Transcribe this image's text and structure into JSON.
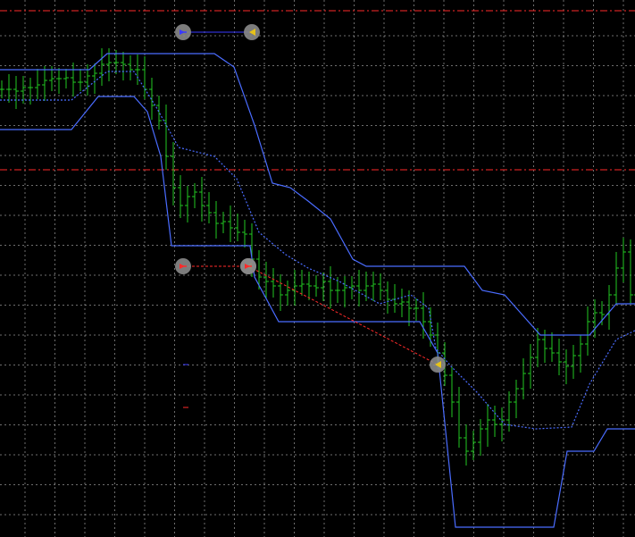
{
  "colors": {
    "background": "#000000",
    "grid": "#c8c8c8",
    "bars": "#22c922",
    "channel": "#4a6cff",
    "midline": "#4a6cff",
    "level": "#ff2a2a",
    "trade_loss": "#ff2a2a",
    "trade_win": "#3a3aff",
    "marker_bg": "#8a8a8a",
    "arrow_close": "#e6c21a",
    "arrow_open": "#ff2a2a"
  },
  "icons": {
    "open_marker": "trade-open-arrow-icon",
    "close_marker": "trade-close-arrow-icon"
  },
  "chart_data": {
    "type": "line",
    "series": [
      {
        "kind": "channel-upper",
        "points": [
          [
            0,
            78
          ],
          [
            100,
            78
          ],
          [
            120,
            60
          ],
          [
            240,
            60
          ],
          [
            262,
            75
          ],
          [
            285,
            140
          ],
          [
            305,
            205
          ],
          [
            325,
            210
          ],
          [
            345,
            225
          ],
          [
            370,
            245
          ],
          [
            395,
            290
          ],
          [
            410,
            298
          ],
          [
            520,
            298
          ],
          [
            540,
            325
          ],
          [
            565,
            330
          ],
          [
            605,
            375
          ],
          [
            660,
            375
          ],
          [
            690,
            340
          ],
          [
            711,
            340
          ]
        ]
      },
      {
        "kind": "channel-lower",
        "points": [
          [
            0,
            145
          ],
          [
            80,
            145
          ],
          [
            110,
            108
          ],
          [
            150,
            108
          ],
          [
            165,
            125
          ],
          [
            180,
            175
          ],
          [
            192,
            275
          ],
          [
            280,
            275
          ],
          [
            285,
            310
          ],
          [
            312,
            360
          ],
          [
            470,
            360
          ],
          [
            490,
            395
          ],
          [
            510,
            590
          ],
          [
            620,
            590
          ],
          [
            635,
            505
          ],
          [
            665,
            505
          ],
          [
            680,
            480
          ],
          [
            711,
            480
          ]
        ]
      },
      {
        "kind": "channel-mid",
        "points": [
          [
            0,
            112
          ],
          [
            80,
            112
          ],
          [
            120,
            80
          ],
          [
            150,
            80
          ],
          [
            175,
            120
          ],
          [
            200,
            165
          ],
          [
            240,
            175
          ],
          [
            265,
            200
          ],
          [
            290,
            260
          ],
          [
            320,
            285
          ],
          [
            345,
            300
          ],
          [
            380,
            315
          ],
          [
            425,
            340
          ],
          [
            460,
            330
          ],
          [
            480,
            345
          ],
          [
            488,
            390
          ],
          [
            505,
            410
          ],
          [
            535,
            440
          ],
          [
            565,
            475
          ],
          [
            600,
            480
          ],
          [
            640,
            478
          ],
          [
            660,
            430
          ],
          [
            690,
            380
          ],
          [
            711,
            370
          ]
        ]
      },
      {
        "kind": "price-bars",
        "points": [
          [
            0,
            100
          ],
          [
            8,
            100
          ],
          [
            16,
            102
          ],
          [
            24,
            98
          ],
          [
            32,
            98
          ],
          [
            40,
            95
          ],
          [
            48,
            90
          ],
          [
            56,
            88
          ],
          [
            64,
            88
          ],
          [
            72,
            87
          ],
          [
            80,
            92
          ],
          [
            88,
            92
          ],
          [
            96,
            85
          ],
          [
            104,
            82
          ],
          [
            112,
            72
          ],
          [
            120,
            70
          ],
          [
            128,
            70
          ],
          [
            136,
            72
          ],
          [
            144,
            78
          ],
          [
            152,
            78
          ],
          [
            160,
            100
          ],
          [
            168,
            118
          ],
          [
            176,
            135
          ],
          [
            184,
            175
          ],
          [
            192,
            210
          ],
          [
            200,
            230
          ],
          [
            208,
            220
          ],
          [
            216,
            215
          ],
          [
            224,
            230
          ],
          [
            232,
            238
          ],
          [
            240,
            250
          ],
          [
            248,
            248
          ],
          [
            256,
            255
          ],
          [
            264,
            260
          ],
          [
            272,
            262
          ],
          [
            280,
            290
          ],
          [
            288,
            310
          ],
          [
            296,
            315
          ],
          [
            304,
            320
          ],
          [
            312,
            330
          ],
          [
            320,
            325
          ],
          [
            328,
            320
          ],
          [
            336,
            318
          ],
          [
            344,
            320
          ],
          [
            352,
            322
          ],
          [
            360,
            315
          ],
          [
            368,
            325
          ],
          [
            376,
            325
          ],
          [
            384,
            322
          ],
          [
            392,
            320
          ],
          [
            400,
            325
          ],
          [
            408,
            320
          ],
          [
            416,
            318
          ],
          [
            424,
            325
          ],
          [
            432,
            335
          ],
          [
            440,
            340
          ],
          [
            448,
            338
          ],
          [
            456,
            345
          ],
          [
            464,
            345
          ],
          [
            472,
            360
          ],
          [
            480,
            375
          ],
          [
            488,
            395
          ],
          [
            496,
            420
          ],
          [
            504,
            450
          ],
          [
            512,
            490
          ],
          [
            520,
            505
          ],
          [
            528,
            495
          ],
          [
            536,
            480
          ],
          [
            544,
            470
          ],
          [
            552,
            475
          ],
          [
            560,
            470
          ],
          [
            568,
            450
          ],
          [
            576,
            435
          ],
          [
            584,
            418
          ],
          [
            592,
            400
          ],
          [
            600,
            380
          ],
          [
            608,
            390
          ],
          [
            616,
            395
          ],
          [
            624,
            405
          ],
          [
            632,
            410
          ],
          [
            640,
            398
          ],
          [
            648,
            385
          ],
          [
            656,
            360
          ],
          [
            664,
            350
          ],
          [
            672,
            352
          ],
          [
            680,
            330
          ],
          [
            688,
            300
          ],
          [
            696,
            282
          ],
          [
            704,
            330
          ],
          [
            711,
            320
          ]
        ]
      }
    ],
    "levels": [
      12,
      190
    ],
    "trades": [
      {
        "kind": "win",
        "open": [
          205,
          36
        ],
        "close": [
          282,
          36
        ]
      },
      {
        "kind": "loss",
        "open": [
          205,
          298
        ],
        "close": [
          278,
          298
        ]
      },
      {
        "kind": "loss",
        "open": [
          278,
          298
        ],
        "close": [
          490,
          408
        ]
      }
    ]
  }
}
